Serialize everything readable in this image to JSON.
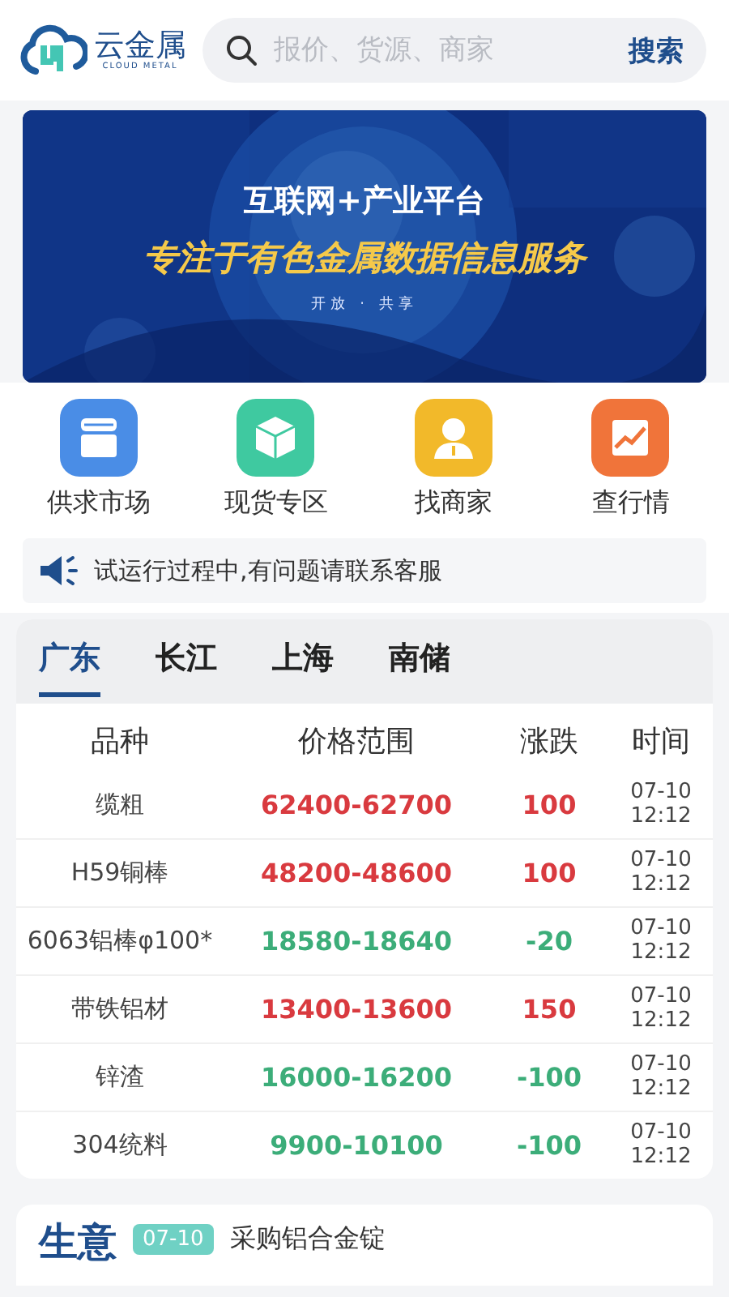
{
  "header": {
    "logo_text": "云金属",
    "logo_subtext": "CLOUD METAL",
    "search": {
      "placeholder": "报价、货源、商家",
      "button": "搜索"
    }
  },
  "banner": {
    "headline": "互联网+产业平台",
    "slogan": "专注于有色金属数据信息服务",
    "tagline": "开放 · 共享"
  },
  "quick_nav": [
    {
      "label": "供求市场",
      "kind": "store",
      "color": "#4a8de6"
    },
    {
      "label": "现货专区",
      "kind": "box",
      "color": "#3fc9a0"
    },
    {
      "label": "找商家",
      "kind": "person",
      "color": "#f2b92a"
    },
    {
      "label": "查行情",
      "kind": "chart",
      "color": "#f0743a"
    }
  ],
  "notice": "试运行过程中,有问题请联系客服",
  "regions": [
    {
      "label": "广东",
      "selected": true
    },
    {
      "label": "长江",
      "selected": false
    },
    {
      "label": "上海",
      "selected": false
    },
    {
      "label": "南储",
      "selected": false
    }
  ],
  "table": {
    "columns": [
      "品种",
      "价格范围",
      "涨跌",
      "时间"
    ],
    "rows": [
      {
        "name": "缆粗",
        "price": "62400-62700",
        "change": "100",
        "color": "#d93a3f",
        "date": "07-10",
        "time": "12:12"
      },
      {
        "name": "H59铜棒",
        "price": "48200-48600",
        "change": "100",
        "color": "#d93a3f",
        "date": "07-10",
        "time": "12:12"
      },
      {
        "name": "6063铝棒φ100*",
        "price": "18580-18640",
        "change": "-20",
        "color": "#3cad79",
        "date": "07-10",
        "time": "12:12"
      },
      {
        "name": "带铁铝材",
        "price": "13400-13600",
        "change": "150",
        "color": "#d93a3f",
        "date": "07-10",
        "time": "12:12"
      },
      {
        "name": "锌渣",
        "price": "16000-16200",
        "change": "-100",
        "color": "#3cad79",
        "date": "07-10",
        "time": "12:12"
      },
      {
        "name": "304统料",
        "price": "9900-10100",
        "change": "-100",
        "color": "#3cad79",
        "date": "07-10",
        "time": "12:12"
      }
    ]
  },
  "news": {
    "title": "生意",
    "items": [
      {
        "date": "07-10",
        "text": "采购铝合金锭"
      }
    ]
  }
}
